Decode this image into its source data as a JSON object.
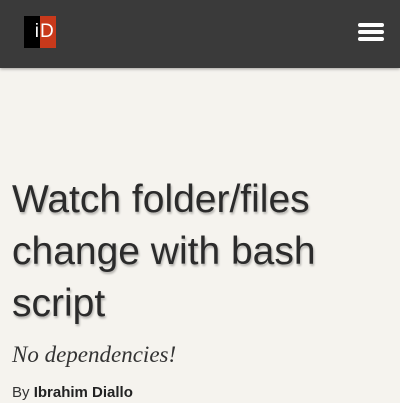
{
  "header": {
    "logo_left": "i",
    "logo_right": "D",
    "menu_icon": "hamburger-menu-icon",
    "bar_color": "#3a3a3a",
    "logo_accent": "#c8391b"
  },
  "article": {
    "title": "Watch folder/files change with bash script",
    "subtitle": "No dependencies!",
    "byline_prefix": "By",
    "author": "Ibrahim Diallo"
  }
}
